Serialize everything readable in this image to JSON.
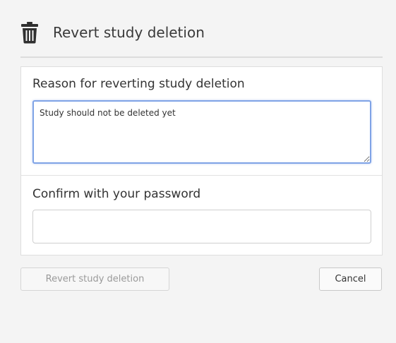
{
  "dialog": {
    "title": "Revert study deletion",
    "icon": "trash-icon"
  },
  "form": {
    "reason_label": "Reason for reverting study deletion",
    "reason_value": "Study should not be deleted yet",
    "password_label": "Confirm with your password",
    "password_value": ""
  },
  "buttons": {
    "revert_label": "Revert study deletion",
    "cancel_label": "Cancel",
    "revert_disabled": true
  },
  "colors": {
    "focus_border": "#7fa3e6",
    "background": "#f4f4f4"
  }
}
